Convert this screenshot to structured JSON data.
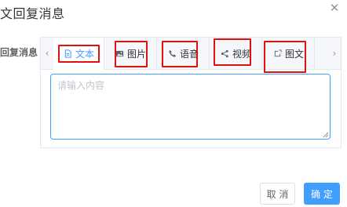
{
  "dialog": {
    "title": "文回复消息"
  },
  "form": {
    "label": "回复消息"
  },
  "tabs": [
    {
      "label": "文本",
      "icon": "document-icon",
      "active": true
    },
    {
      "label": "图片",
      "icon": "image-icon",
      "active": false
    },
    {
      "label": "语音",
      "icon": "phone-icon",
      "active": false
    },
    {
      "label": "视频",
      "icon": "share-icon",
      "active": false
    },
    {
      "label": "图文",
      "icon": "news-icon",
      "active": false
    }
  ],
  "textarea": {
    "placeholder": "请输入内容"
  },
  "footer": {
    "cancel_label": "取 消",
    "confirm_label": "确 定"
  },
  "colors": {
    "accent": "#409eff",
    "highlight": "#e0110f",
    "border": "#e4e7ed"
  }
}
